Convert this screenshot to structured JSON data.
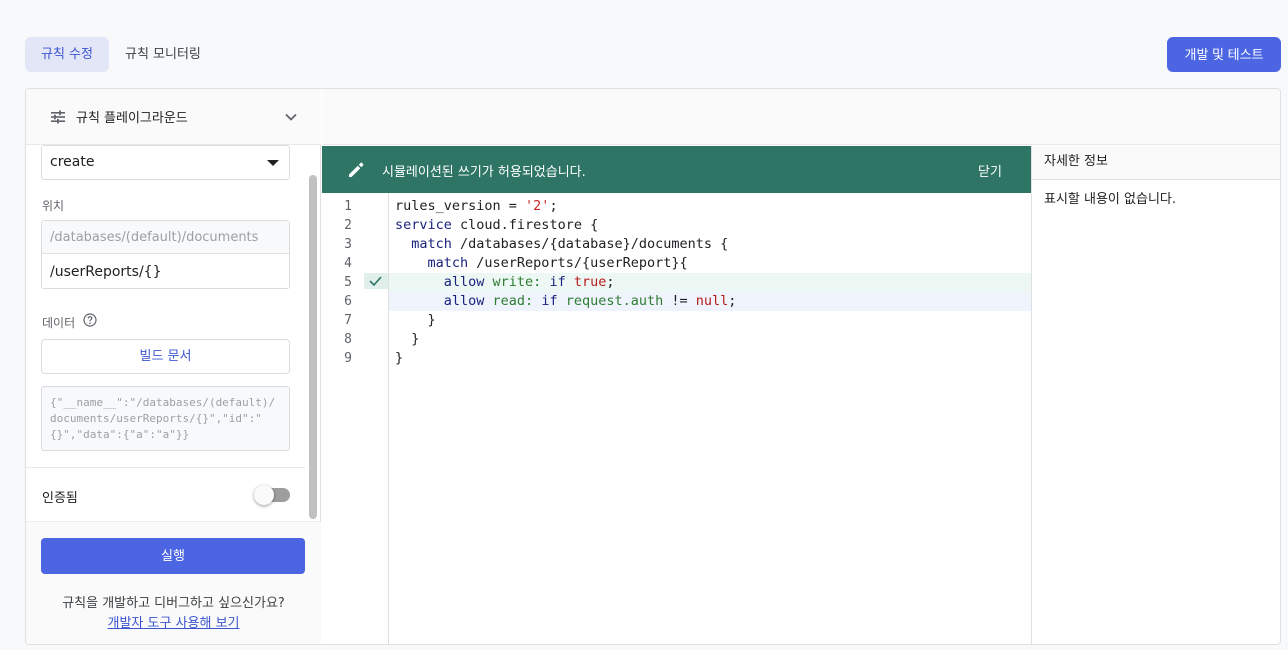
{
  "tabs": {
    "edit": "규칙 수정",
    "monitor": "규칙 모니터링"
  },
  "dev_test_button": "개발 및 테스트",
  "playground": {
    "title": "규칙 플레이그라운드",
    "operation": "create",
    "location_label": "위치",
    "path_prefix": "/databases/(default)/documents",
    "path_value": "/userReports/{}",
    "data_label": "데이터",
    "build_doc_button": "빌드 문서",
    "json_preview": "{\"__name__\":\"/databases/(default)/documents/userReports/{}\",\"id\":\"{}\",\"data\":{\"a\":\"a\"}}",
    "auth_label": "인증됨",
    "auth_enabled": false,
    "run_button": "실행",
    "hint": "규칙을 개발하고 디버그하고 싶으신가요?",
    "hint_link": "개발자 도구 사용해 보기"
  },
  "banner": {
    "message": "시뮬레이션된 쓰기가 허용되었습니다.",
    "close": "닫기",
    "color": "#2e7565"
  },
  "editor": {
    "line_numbers": [
      "1",
      "2",
      "3",
      "4",
      "5",
      "6",
      "7",
      "8",
      "9"
    ],
    "lines": [
      {
        "parts": [
          {
            "t": "rules_version = ",
            "c": ""
          },
          {
            "t": "'2'",
            "c": "str"
          },
          {
            "t": ";",
            "c": ""
          }
        ]
      },
      {
        "parts": [
          {
            "t": "service",
            "c": "kw"
          },
          {
            "t": " cloud.firestore {",
            "c": ""
          }
        ]
      },
      {
        "parts": [
          {
            "t": "  match",
            "c": "kw"
          },
          {
            "t": " /databases/{database}/documents {",
            "c": ""
          }
        ]
      },
      {
        "parts": [
          {
            "t": "    match",
            "c": "kw"
          },
          {
            "t": " /userReports/{userReport}{",
            "c": ""
          }
        ]
      },
      {
        "parts": [
          {
            "t": "      allow",
            "c": "kw"
          },
          {
            "t": " write:",
            "c": "grn"
          },
          {
            "t": " if",
            "c": "kw"
          },
          {
            "t": " true",
            "c": "red"
          },
          {
            "t": ";",
            "c": ""
          }
        ]
      },
      {
        "parts": [
          {
            "t": "      allow",
            "c": "kw"
          },
          {
            "t": " read:",
            "c": "grn"
          },
          {
            "t": " if",
            "c": "kw"
          },
          {
            "t": " request.auth",
            "c": "grn"
          },
          {
            "t": " != ",
            "c": ""
          },
          {
            "t": "null",
            "c": "red"
          },
          {
            "t": ";",
            "c": ""
          }
        ]
      },
      {
        "parts": [
          {
            "t": "    }",
            "c": ""
          }
        ]
      },
      {
        "parts": [
          {
            "t": "  }",
            "c": ""
          }
        ]
      },
      {
        "parts": [
          {
            "t": "}",
            "c": ""
          }
        ]
      }
    ]
  },
  "details": {
    "title": "자세한 정보",
    "empty": "표시할 내용이 없습니다."
  }
}
